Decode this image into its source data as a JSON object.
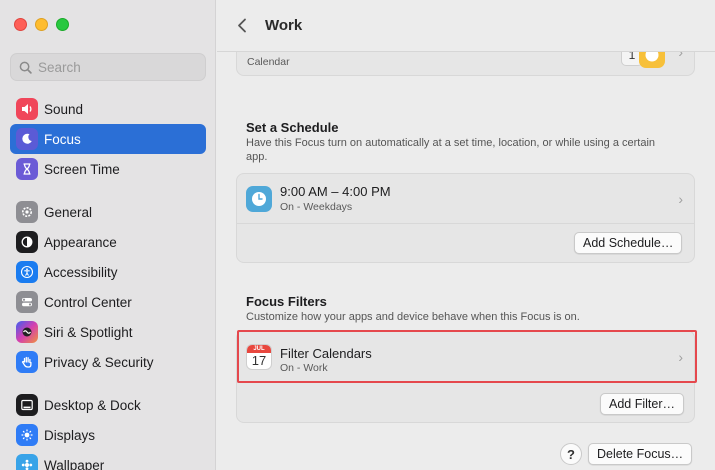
{
  "window": {
    "traffic_lights": [
      "close",
      "minimize",
      "zoom"
    ]
  },
  "sidebar": {
    "search_placeholder": "Search",
    "items": [
      {
        "label": "Sound",
        "icon": "speaker-icon",
        "color": "#f0465a"
      },
      {
        "label": "Focus",
        "icon": "moon-icon",
        "color": "#5b5bd6",
        "active": true
      },
      {
        "label": "Screen Time",
        "icon": "hourglass-icon",
        "color": "#6b5bd6"
      },
      {
        "label": "General",
        "icon": "gear-icon",
        "color": "#8e8e93"
      },
      {
        "label": "Appearance",
        "icon": "appearance-icon",
        "color": "#1d1d1f"
      },
      {
        "label": "Accessibility",
        "icon": "accessibility-icon",
        "color": "#1a7cf0"
      },
      {
        "label": "Control Center",
        "icon": "toggles-icon",
        "color": "#8e8e93"
      },
      {
        "label": "Siri & Spotlight",
        "icon": "siri-icon",
        "color": "#b443d8"
      },
      {
        "label": "Privacy & Security",
        "icon": "hand-icon",
        "color": "#2f7cf6"
      },
      {
        "label": "Desktop & Dock",
        "icon": "dock-icon",
        "color": "#1d1d1f"
      },
      {
        "label": "Displays",
        "icon": "sun-icon",
        "color": "#2f7cf6"
      },
      {
        "label": "Wallpaper",
        "icon": "wallpaper-icon",
        "color": "#38a3e8"
      }
    ],
    "accent": "#2b6fd6"
  },
  "header": {
    "title": "Work"
  },
  "top_card": {
    "subtitle": "Calendar",
    "badge": "1"
  },
  "schedule": {
    "title": "Set a Schedule",
    "description": "Have this Focus turn on automatically at a set time, location, or while using a certain app.",
    "row_title": "9:00 AM – 4:00 PM",
    "row_subtitle": "On - Weekdays",
    "add_button": "Add Schedule…"
  },
  "filters": {
    "title": "Focus Filters",
    "description": "Customize how your apps and device behave when this Focus is on.",
    "row_title": "Filter Calendars",
    "row_subtitle": "On - Work",
    "calendar_month": "JUL",
    "calendar_day": "17",
    "add_button": "Add Filter…"
  },
  "footer": {
    "help": "?",
    "delete_button": "Delete Focus…"
  },
  "highlight_color": "#e5484d"
}
